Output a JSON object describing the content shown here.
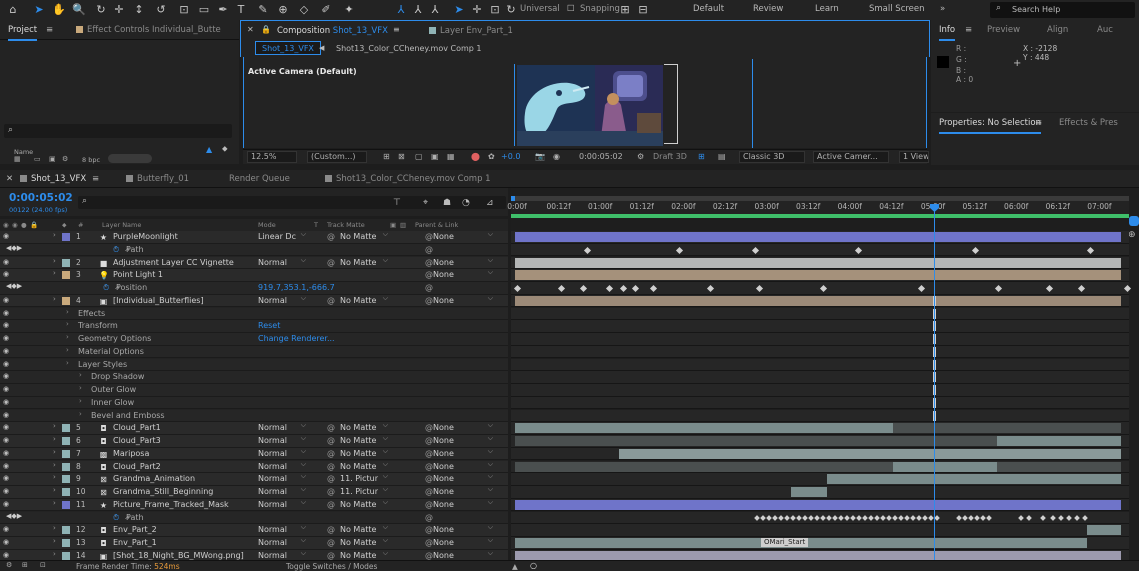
{
  "toolbar": {
    "universal_label": "Universal",
    "snapping_label": "Snapping",
    "workspaces": [
      "Default",
      "Review",
      "Learn",
      "Small Screen"
    ],
    "search_placeholder": "Search Help"
  },
  "project_panel": {
    "tab_project": "Project",
    "tab_effect_controls": "Effect Controls Individual_Butte",
    "name_col": "Name",
    "bpc": "8 bpc"
  },
  "composition_panel": {
    "tab_composition_prefix": "Composition",
    "tab_composition_name": "Shot_13_VFX",
    "tab_layer": "Layer  Env_Part_1",
    "subtab_active": "Shot_13_VFX",
    "subtab_other": "Shot13_Color_CCheney.mov Comp 1",
    "camera_label": "Active Camera (Default)",
    "zoom": "12.5%",
    "resolution": "(Custom...)",
    "exposure": "+0.0",
    "current_time": "0:00:05:02",
    "draft_label": "Draft 3D",
    "renderer": "Classic 3D",
    "camera_select": "Active Camer...",
    "view_count": "1 View"
  },
  "info_panel": {
    "tabs": [
      "Info",
      "Preview",
      "Align",
      "Auc"
    ],
    "r": "R :",
    "g": "G :",
    "b": "B :",
    "a": "A : 0",
    "x": "X : -2128",
    "y": "Y : 448",
    "props_tab": "Properties: No Selection",
    "effects_tab": "Effects & Pres"
  },
  "timeline": {
    "tabs": [
      "Shot_13_VFX",
      "Butterfly_01",
      "Render Queue",
      "Shot13_Color_CCheney.mov Comp 1"
    ],
    "timecode": "0:00:05:02",
    "fps": "00122 (24.00 fps)",
    "col_layer_name": "Layer Name",
    "col_mode": "Mode",
    "col_t": "T",
    "col_track_matte": "Track Matte",
    "col_parent": "Parent & Link",
    "ruler": [
      "0:00f",
      "00:12f",
      "01:00f",
      "01:12f",
      "02:00f",
      "02:12f",
      "03:00f",
      "03:12f",
      "04:00f",
      "04:12f",
      "05:00f",
      "05:12f",
      "06:00f",
      "06:12f",
      "07:00f"
    ],
    "marker_label": "OMari_Start",
    "status_render": "Frame Render Time:",
    "status_render_value": "524ms",
    "status_toggle": "Toggle Switches / Modes"
  },
  "layers": [
    {
      "num": "1",
      "name": "PurpleMoonlight",
      "mode": "Linear Dc",
      "tm": "No Matte",
      "parent": "None",
      "color": "#6f74c9",
      "icon": "★"
    },
    {
      "sub": "Path",
      "indent": 126
    },
    {
      "num": "2",
      "name": "Adjustment Layer CC Vignette",
      "mode": "Normal",
      "tm": "No Matte",
      "parent": "None",
      "color": "#8fb3b5",
      "icon": "■"
    },
    {
      "num": "3",
      "name": "Point Light 1",
      "mode": "",
      "tm": "",
      "parent": "None",
      "color": "#c9a97c",
      "icon": "💡"
    },
    {
      "sub": "Position",
      "indent": 116,
      "value": "919.7,353.1,-666.7"
    },
    {
      "num": "4",
      "name": "[Individual_Butterflies]",
      "mode": "Normal",
      "tm": "No Matte",
      "parent": "None",
      "color": "#c9a97c",
      "icon": "▣"
    },
    {
      "sub": "Effects",
      "indent": 78
    },
    {
      "sub": "Transform",
      "indent": 78,
      "value": "Reset"
    },
    {
      "sub": "Geometry Options",
      "indent": 78,
      "dim": true,
      "value": "Change Renderer..."
    },
    {
      "sub": "Material Options",
      "indent": 78
    },
    {
      "sub": "Layer Styles",
      "indent": 78
    },
    {
      "sub": "Drop Shadow",
      "indent": 91
    },
    {
      "sub": "Outer Glow",
      "indent": 91
    },
    {
      "sub": "Inner Glow",
      "indent": 91
    },
    {
      "sub": "Bevel and Emboss",
      "indent": 91
    },
    {
      "num": "5",
      "name": "Cloud_Part1",
      "mode": "Normal",
      "tm": "No Matte",
      "parent": "None",
      "color": "#8fb3b5",
      "icon": "◘"
    },
    {
      "num": "6",
      "name": "Cloud_Part3",
      "mode": "Normal",
      "tm": "No Matte",
      "parent": "None",
      "color": "#8fb3b5",
      "icon": "◘"
    },
    {
      "num": "7",
      "name": "Mariposa",
      "mode": "Normal",
      "tm": "No Matte",
      "parent": "None",
      "color": "#8fb3b5",
      "icon": "▩"
    },
    {
      "num": "8",
      "name": "Cloud_Part2",
      "mode": "Normal",
      "tm": "No Matte",
      "parent": "None",
      "color": "#8fb3b5",
      "icon": "◘"
    },
    {
      "num": "9",
      "name": "Grandma_Animation",
      "mode": "Normal",
      "tm": "11. Pictur",
      "parent": "None",
      "color": "#8fb3b5",
      "icon": "⊠"
    },
    {
      "num": "10",
      "name": "Grandma_Still_Beginning",
      "mode": "Normal",
      "tm": "11. Pictur",
      "parent": "None",
      "color": "#8fb3b5",
      "icon": "⊠"
    },
    {
      "num": "11",
      "name": "Picture_Frame_Tracked_Mask",
      "mode": "Normal",
      "tm": "No Matte",
      "parent": "None",
      "color": "#6f74c9",
      "icon": "★"
    },
    {
      "sub": "Path",
      "indent": 126
    },
    {
      "num": "12",
      "name": "Env_Part_2",
      "mode": "Normal",
      "tm": "No Matte",
      "parent": "None",
      "color": "#8fb3b5",
      "icon": "◘"
    },
    {
      "num": "13",
      "name": "Env_Part_1",
      "mode": "Normal",
      "tm": "No Matte",
      "parent": "None",
      "color": "#8fb3b5",
      "icon": "◘"
    },
    {
      "num": "14",
      "name": "[Shot_18_Night_BG_MWong.png]",
      "mode": "Normal",
      "tm": "No Matte",
      "parent": "None",
      "color": "#8fb3b5",
      "icon": "▣"
    }
  ]
}
